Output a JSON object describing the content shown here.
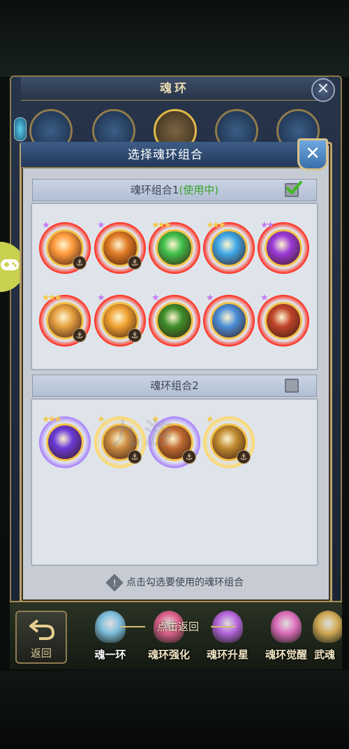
{
  "back_panel": {
    "title": "魂环",
    "close_icon": "close-icon"
  },
  "modal": {
    "title": "选择魂环组合",
    "close_icon": "close-icon",
    "groups": [
      {
        "label": "魂环组合1",
        "status": "(使用中)",
        "checked": true,
        "rings": [
          {
            "stars": "★",
            "star_color": "#c27cf2",
            "fill": "#ff9a3c",
            "glow": "#ff2a1a",
            "anchor": true
          },
          {
            "stars": "★",
            "star_color": "#c27cf2",
            "fill": "#e07a24",
            "glow": "#ff2a1a",
            "anchor": true
          },
          {
            "stars": "★★★",
            "star_color": "#f4c94a",
            "fill": "#3fbf4a",
            "glow": "#ff2a1a",
            "anchor": false
          },
          {
            "stars": "★★★",
            "star_color": "#f4c94a",
            "fill": "#3fa8e8",
            "glow": "#ff2a1a",
            "anchor": false
          },
          {
            "stars": "★★",
            "star_color": "#c27cf2",
            "fill": "#9a3ad8",
            "glow": "#ff2a1a",
            "anchor": false
          },
          {
            "stars": "★★★",
            "star_color": "#f4c94a",
            "fill": "#e6a040",
            "glow": "#ff2a1a",
            "anchor": true
          },
          {
            "stars": "★",
            "star_color": "#c27cf2",
            "fill": "#f0a030",
            "glow": "#ff2a1a",
            "anchor": true
          },
          {
            "stars": "★",
            "star_color": "#c27cf2",
            "fill": "#3c8e2a",
            "glow": "#ff2a1a",
            "anchor": false
          },
          {
            "stars": "★",
            "star_color": "#c27cf2",
            "fill": "#4a8ed8",
            "glow": "#ff2a1a",
            "anchor": false
          },
          {
            "stars": "★",
            "star_color": "#c27cf2",
            "fill": "#c0442a",
            "glow": "#ff2a1a",
            "anchor": false
          }
        ]
      },
      {
        "label": "魂环组合2",
        "status": "",
        "checked": false,
        "rings": [
          {
            "stars": "★★★",
            "star_color": "#f4c94a",
            "fill": "#6a3ad8",
            "glow": "#a880ff",
            "anchor": false
          },
          {
            "stars": "★",
            "star_color": "#f4c94a",
            "fill": "#c98a40",
            "glow": "#ffd860",
            "anchor": true
          },
          {
            "stars": "★",
            "star_color": "#f4c94a",
            "fill": "#c06a30",
            "glow": "#a880ff",
            "anchor": true
          },
          {
            "stars": "★",
            "star_color": "#f4c94a",
            "fill": "#c08a30",
            "glow": "#ffd860",
            "anchor": true
          }
        ]
      }
    ],
    "hint": "点击勾选要使用的魂环组合"
  },
  "bottom": {
    "back_label": "返回",
    "tip": "点击返回",
    "tabs": [
      {
        "label": "魂一环",
        "gem": "#8fd8ff"
      },
      {
        "label": "魂环强化",
        "gem": "#ff6aa0"
      },
      {
        "label": "魂环升星",
        "gem": "#d070ff"
      },
      {
        "label": "魂环觉醒",
        "gem": "#ff7ad8"
      },
      {
        "label": "武魂",
        "gem": "#f0c060"
      }
    ]
  },
  "watermark": "九游"
}
